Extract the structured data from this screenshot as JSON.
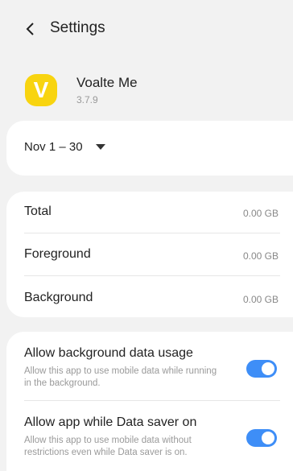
{
  "header": {
    "title": "Settings"
  },
  "app": {
    "name": "Voalte Me",
    "version": "3.7.9",
    "icon_letter": "V",
    "icon_color": "#f8d410"
  },
  "period": {
    "selected": "Nov 1 – 30"
  },
  "usage": {
    "rows": [
      {
        "label": "Total",
        "value": "0.00 GB"
      },
      {
        "label": "Foreground",
        "value": "0.00 GB"
      },
      {
        "label": "Background",
        "value": "0.00 GB"
      }
    ]
  },
  "settings": {
    "items": [
      {
        "title": "Allow background data usage",
        "description": "Allow this app to use mobile data while running in the background.",
        "enabled": true
      },
      {
        "title": "Allow app while Data saver on",
        "description": "Allow this app to use mobile data without restrictions even while Data saver is on.",
        "enabled": true
      }
    ]
  },
  "colors": {
    "accent": "#3e8ef7",
    "background": "#f2f2f2",
    "card": "#ffffff"
  }
}
